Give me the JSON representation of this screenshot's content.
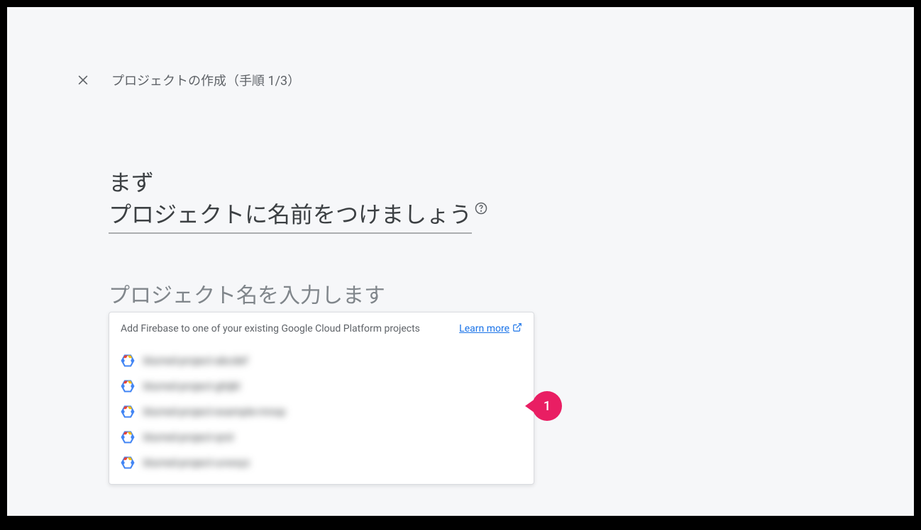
{
  "header": {
    "breadcrumb": "プロジェクトの作成（手順 1/3）"
  },
  "heading": {
    "line1": "まず",
    "line2": "プロジェクトに名前をつけましょう"
  },
  "input": {
    "label": "プロジェクト名を入力します"
  },
  "dropdown": {
    "hint": "Add Firebase to one of your existing Google Cloud Platform projects",
    "learn_more": "Learn more",
    "items": [
      {
        "label": "blurred-project-abcdef"
      },
      {
        "label": "blurred-project-ghijkl"
      },
      {
        "label": "blurred-project-example-mnop"
      },
      {
        "label": "blurred-project-qrst"
      },
      {
        "label": "blurred-project-uvwxyz"
      }
    ]
  },
  "callout": {
    "number": "1"
  }
}
